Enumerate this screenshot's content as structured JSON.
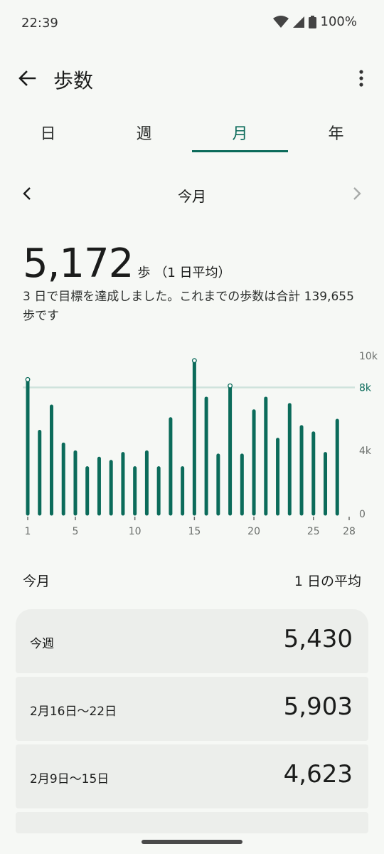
{
  "status_bar": {
    "time": "22:39",
    "battery": "100%"
  },
  "app_bar": {
    "title": "歩数"
  },
  "tabs": [
    {
      "label": "日",
      "active": false
    },
    {
      "label": "週",
      "active": false
    },
    {
      "label": "月",
      "active": true
    },
    {
      "label": "年",
      "active": false
    }
  ],
  "period": {
    "label": "今月"
  },
  "summary": {
    "value": "5,172",
    "unit": "歩",
    "note": "（1 日平均）",
    "description": "3 日で目標を達成しました。これまでの歩数は合計 139,655 歩です"
  },
  "chart_data": {
    "type": "bar",
    "x": [
      1,
      2,
      3,
      4,
      5,
      6,
      7,
      8,
      9,
      10,
      11,
      12,
      13,
      14,
      15,
      16,
      17,
      18,
      19,
      20,
      21,
      22,
      23,
      24,
      25,
      26,
      27
    ],
    "values": [
      8500,
      5200,
      6800,
      4400,
      3900,
      2900,
      3500,
      3300,
      3800,
      2900,
      3900,
      2900,
      6000,
      2900,
      9700,
      7300,
      3700,
      8100,
      3700,
      6500,
      7300,
      4700,
      6900,
      5500,
      5100,
      3800,
      5900
    ],
    "goal_met_days": [
      1,
      15,
      18
    ],
    "goal": 8000,
    "xlim": [
      1,
      28
    ],
    "ylim": [
      0,
      10000
    ],
    "x_ticks": [
      1,
      5,
      10,
      15,
      20,
      25,
      28
    ],
    "y_ticks": [
      {
        "value": 0,
        "label": "0"
      },
      {
        "value": 4000,
        "label": "4k"
      },
      {
        "value": 8000,
        "label": "8k"
      },
      {
        "value": 10000,
        "label": "10k"
      }
    ],
    "colors": {
      "bar": "#0b6b5a",
      "goal_line": "#cfe3dc",
      "goal_label": "#0b6b5a",
      "axis_text": "#6b6f6c"
    }
  },
  "section": {
    "title": "今月",
    "right": "1 日の平均"
  },
  "rows": [
    {
      "label": "今週",
      "value": "5,430"
    },
    {
      "label": "2月16日〜22日",
      "value": "5,903"
    },
    {
      "label": "2月9日〜15日",
      "value": "4,623"
    }
  ]
}
